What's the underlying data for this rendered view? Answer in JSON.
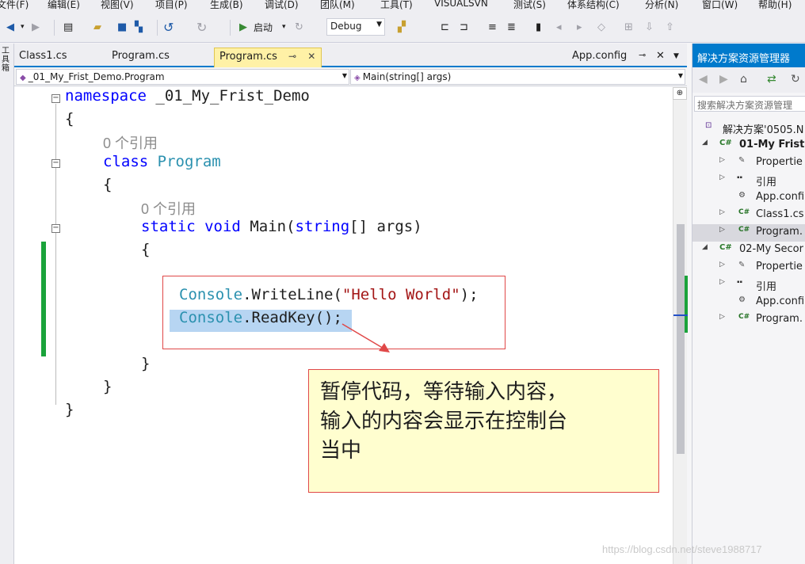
{
  "menu": [
    "文件(F)",
    "编辑(E)",
    "视图(V)",
    "项目(P)",
    "生成(B)",
    "调试(D)",
    "团队(M)",
    "工具(T)",
    "VISUALSVN",
    "测试(S)",
    "体系结构(C)",
    "分析(N)",
    "窗口(W)",
    "帮助(H)"
  ],
  "toolbar": {
    "start_label": "启动",
    "config_value": "Debug"
  },
  "left_strip": "工具箱",
  "tabs": [
    {
      "label": "Class1.cs",
      "active": false
    },
    {
      "label": "Program.cs",
      "active": false
    },
    {
      "label": "Program.cs",
      "active": true
    }
  ],
  "tab_right": "App.config",
  "nav": {
    "class_path": "_01_My_Frist_Demo.Program",
    "member": "Main(string[] args)"
  },
  "code": {
    "ns_keyword": "namespace",
    "ns_name": " _01_My_Frist_Demo",
    "brace_open": "{",
    "brace_close": "}",
    "ref_count": "0 个引用",
    "class_keyword": "class",
    "class_name": "Program",
    "static_kw": "static",
    "void_kw": "void",
    "main": "Main(",
    "string_kw": "string",
    "args": "[] args)",
    "console": "Console",
    "writeline": ".WriteLine(",
    "hello": "\"Hello World\"",
    "end_stmt": ");",
    "readkey": ".ReadKey();"
  },
  "callout": {
    "line1": "暂停代码，等待输入内容，",
    "line2": "输入的内容会显示在控制台",
    "line3": "当中"
  },
  "solution_explorer": {
    "title": "解决方案资源管理器",
    "search_placeholder": "搜索解决方案资源管理",
    "items": [
      {
        "label": "解决方案'0505.N",
        "icon": "solution-icon",
        "depth": 0,
        "expander": ""
      },
      {
        "label": "01-My Frist",
        "icon": "csproj-icon",
        "depth": 1,
        "expander": "◢",
        "bold": true
      },
      {
        "label": "Propertie",
        "icon": "wrench-icon",
        "depth": 2,
        "expander": "▷"
      },
      {
        "label": "引用",
        "icon": "references-icon",
        "depth": 2,
        "expander": "▷"
      },
      {
        "label": "App.confi",
        "icon": "config-icon",
        "depth": 2,
        "expander": ""
      },
      {
        "label": "Class1.cs",
        "icon": "csharp-file-icon",
        "depth": 2,
        "expander": "▷"
      },
      {
        "label": "Program.",
        "icon": "csharp-file-icon",
        "depth": 2,
        "expander": "▷",
        "selected": true
      },
      {
        "label": "02-My Secor",
        "icon": "csproj-icon",
        "depth": 1,
        "expander": "◢"
      },
      {
        "label": "Propertie",
        "icon": "wrench-icon",
        "depth": 2,
        "expander": "▷"
      },
      {
        "label": "引用",
        "icon": "references-icon",
        "depth": 2,
        "expander": "▷"
      },
      {
        "label": "App.confi",
        "icon": "config-icon",
        "depth": 2,
        "expander": ""
      },
      {
        "label": "Program.",
        "icon": "csharp-file-icon",
        "depth": 2,
        "expander": "▷"
      }
    ]
  },
  "watermark": "https://blog.csdn.net/steve1988717",
  "colors": {
    "accent": "#007acc",
    "active_tab": "#fff1a6",
    "change_bar": "#1aa33a",
    "callout_bg": "#fffecf",
    "callout_border": "#e04848",
    "selection": "#b7d5f2"
  }
}
